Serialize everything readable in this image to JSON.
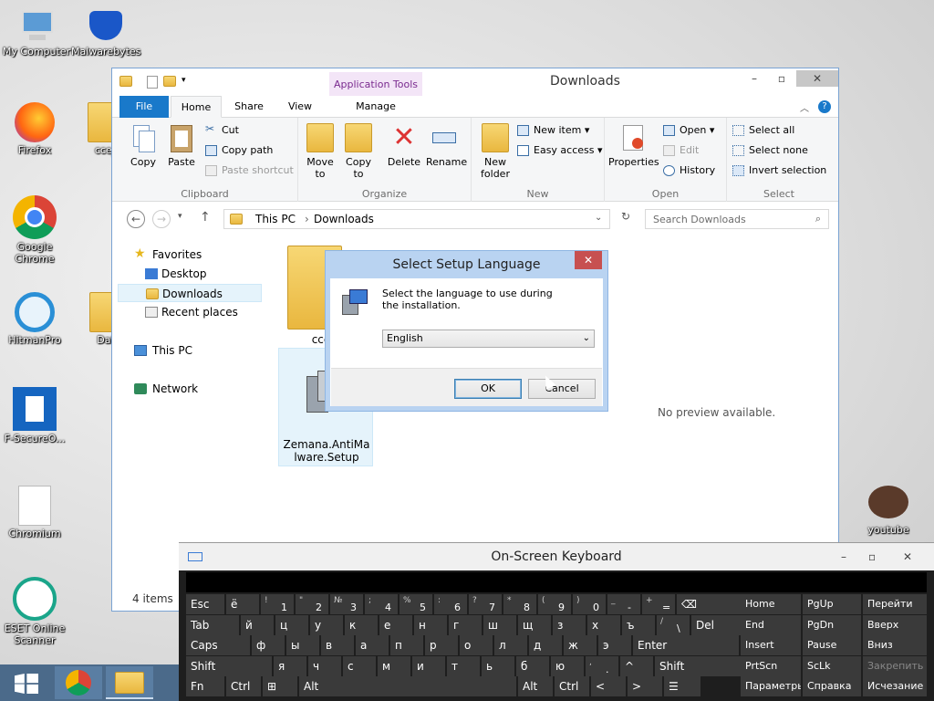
{
  "desktop": {
    "icons": [
      {
        "label": "My Computer",
        "icon": "computer-icon"
      },
      {
        "label": "Malwarebytes",
        "icon": "malwarebytes-icon"
      },
      {
        "label": "Firefox",
        "icon": "firefox-icon"
      },
      {
        "label": "cce_",
        "icon": "folder-icon"
      },
      {
        "label": "Google Chrome",
        "icon": "chrome-icon"
      },
      {
        "label": "HitmanPro",
        "icon": "hitmanpro-icon"
      },
      {
        "label": "Dat",
        "icon": "folder-icon"
      },
      {
        "label": "F-SecureO...",
        "icon": "fsecure-icon"
      },
      {
        "label": "Chromium",
        "icon": "file-icon"
      },
      {
        "label": "ESET Online Scanner",
        "icon": "eset-icon"
      },
      {
        "label": "youtube",
        "icon": "youtube-icon"
      }
    ]
  },
  "explorer": {
    "title": "Downloads",
    "context_tab": "Application Tools",
    "tabs": [
      "File",
      "Home",
      "Share",
      "View",
      "Manage"
    ],
    "ribbon": {
      "clipboard": {
        "label": "Clipboard",
        "copy": "Copy",
        "paste": "Paste",
        "cut": "Cut",
        "copy_path": "Copy path",
        "paste_shortcut": "Paste shortcut"
      },
      "organize": {
        "label": "Organize",
        "move_to": "Move to",
        "copy_to": "Copy to",
        "delete": "Delete",
        "rename": "Rename"
      },
      "new": {
        "label": "New",
        "new_folder": "New folder",
        "new_item": "New item",
        "easy_access": "Easy access"
      },
      "open": {
        "label": "Open",
        "properties": "Properties",
        "open": "Open",
        "edit": "Edit",
        "history": "History"
      },
      "select": {
        "label": "Select",
        "select_all": "Select all",
        "select_none": "Select none",
        "invert_selection": "Invert selection"
      }
    },
    "address": {
      "crumbs": [
        "This PC",
        "Downloads"
      ],
      "search_placeholder": "Search Downloads"
    },
    "nav": {
      "favorites": "Favorites",
      "desktop": "Desktop",
      "downloads": "Downloads",
      "recent": "Recent places",
      "this_pc": "This PC",
      "network": "Network"
    },
    "files": [
      {
        "name": "cce_",
        "icon": "folder-icon"
      },
      {
        "name": "Zemana.AntiMalware.Setup",
        "icon": "installer-icon"
      }
    ],
    "preview_text": "No preview available.",
    "status": "4 items"
  },
  "dialog": {
    "title": "Select Setup Language",
    "message": "Select the language to use during the installation.",
    "selected_language": "English",
    "ok": "OK",
    "cancel": "Cancel"
  },
  "keyboard": {
    "title": "On-Screen Keyboard",
    "rows": [
      [
        [
          "Esc",
          ""
        ],
        [
          "ё",
          ""
        ],
        [
          "1",
          "!"
        ],
        [
          "2",
          "\""
        ],
        [
          "3",
          "№"
        ],
        [
          "4",
          ";"
        ],
        [
          "5",
          "%"
        ],
        [
          "6",
          ":"
        ],
        [
          "7",
          "?"
        ],
        [
          "8",
          "*"
        ],
        [
          "9",
          "("
        ],
        [
          "0",
          ")"
        ],
        [
          "-",
          "_"
        ],
        [
          "=",
          "+"
        ],
        [
          "⌫",
          ""
        ]
      ],
      [
        [
          "Tab",
          ""
        ],
        [
          "й",
          ""
        ],
        [
          "ц",
          ""
        ],
        [
          "у",
          ""
        ],
        [
          "к",
          ""
        ],
        [
          "е",
          ""
        ],
        [
          "н",
          ""
        ],
        [
          "г",
          ""
        ],
        [
          "ш",
          ""
        ],
        [
          "щ",
          ""
        ],
        [
          "з",
          ""
        ],
        [
          "х",
          ""
        ],
        [
          "ъ",
          ""
        ],
        [
          "\\",
          "/"
        ],
        [
          "Del",
          ""
        ]
      ],
      [
        [
          "Caps",
          ""
        ],
        [
          "ф",
          ""
        ],
        [
          "ы",
          ""
        ],
        [
          "в",
          ""
        ],
        [
          "а",
          ""
        ],
        [
          "п",
          ""
        ],
        [
          "р",
          ""
        ],
        [
          "о",
          ""
        ],
        [
          "л",
          ""
        ],
        [
          "д",
          ""
        ],
        [
          "ж",
          ""
        ],
        [
          "э",
          ""
        ],
        [
          "Enter",
          ""
        ]
      ],
      [
        [
          "Shift",
          ""
        ],
        [
          "я",
          ""
        ],
        [
          "ч",
          ""
        ],
        [
          "с",
          ""
        ],
        [
          "м",
          ""
        ],
        [
          "и",
          ""
        ],
        [
          "т",
          ""
        ],
        [
          "ь",
          ""
        ],
        [
          "б",
          ""
        ],
        [
          "ю",
          ""
        ],
        [
          ".",
          ","
        ],
        [
          "^",
          ""
        ],
        [
          "Shift",
          ""
        ]
      ],
      [
        [
          "Fn",
          ""
        ],
        [
          "Ctrl",
          ""
        ],
        [
          "⊞",
          ""
        ],
        [
          "Alt",
          ""
        ],
        [
          "Alt",
          ""
        ],
        [
          "Ctrl",
          ""
        ],
        [
          "<",
          ""
        ],
        [
          ">",
          ""
        ],
        [
          "☰",
          ""
        ]
      ]
    ],
    "nav_keys": [
      [
        "Home",
        "PgUp",
        "Перейти"
      ],
      [
        "End",
        "PgDn",
        "Вверх"
      ],
      [
        "Insert",
        "Pause",
        "Вниз"
      ],
      [
        "PrtScn",
        "ScLk",
        "Закрепить"
      ],
      [
        "Параметры",
        "Справка",
        "Исчезание"
      ]
    ]
  }
}
